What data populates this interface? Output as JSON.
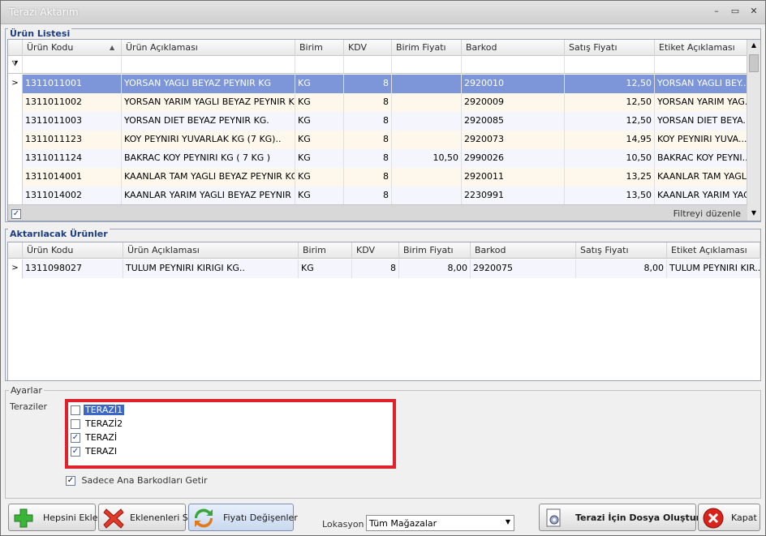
{
  "window": {
    "title": "Terazi Aktarım"
  },
  "product_list": {
    "title": "Ürün Listesi",
    "columns": [
      "Ürün Kodu",
      "Ürün Açıklaması",
      "Birim",
      "KDV",
      "Birim Fiyatı",
      "Barkod",
      "Satış Fiyatı",
      "Etiket Açıklaması"
    ],
    "rows": [
      [
        "1311011001",
        "YORSAN YAGLI BEYAZ PEYNIR KG",
        "KG",
        "8",
        "",
        "2920010",
        "12,50",
        "YORSAN YAGLI BEY..."
      ],
      [
        "1311011002",
        "YORSAN YARIM YAGLI BEYAZ PEYNIR KG..",
        "KG",
        "8",
        "",
        "2920009",
        "12,50",
        "YORSAN YARIM YAG..."
      ],
      [
        "1311011003",
        "YORSAN DIET BEYAZ PEYNIR KG.",
        "KG",
        "8",
        "",
        "2920085",
        "12,50",
        "YORSAN DIET BEYA..."
      ],
      [
        "1311011123",
        "KOY PEYNIRI YUVARLAK KG (7 KG)..",
        "KG",
        "8",
        "",
        "2920073",
        "14,95",
        "KOY PEYNIRI YUVA..."
      ],
      [
        "1311011124",
        "BAKRAC KOY PEYNIRI KG ( 7 KG )",
        "KG",
        "8",
        "10,50",
        "2990026",
        "10,50",
        "BAKRAC KOY PEYNI..."
      ],
      [
        "1311014001",
        "KAANLAR TAM YAGLI BEYAZ PEYNIR KG",
        "KG",
        "8",
        "",
        "2920011",
        "13,25",
        "KAANLAR TAM YAGLI..."
      ],
      [
        "1311014002",
        "KAANLAR YARIM YAGLI BEYAZ PEYNIR KG",
        "KG",
        "8",
        "",
        "2230991",
        "13,50",
        "KAANLAR YARIM YAG..."
      ]
    ],
    "filter_edit": "Filtreyi düzenle"
  },
  "transfer_list": {
    "title": "Aktarılacak Ürünler",
    "columns": [
      "Ürün Kodu",
      "Ürün Açıklaması",
      "Birim",
      "KDV",
      "Birim Fiyatı",
      "Barkod",
      "Satış Fiyatı",
      "Etiket Açıklaması"
    ],
    "rows": [
      [
        "1311098027",
        "TULUM PEYNIRI KIRIGI KG..",
        "KG",
        "8",
        "8,00",
        "2920075",
        "8,00",
        "TULUM PEYNIRI KIR..."
      ]
    ]
  },
  "settings": {
    "title": "Ayarlar",
    "scales_label": "Teraziler",
    "scales": [
      {
        "name": "TERAZİ1",
        "checked": false
      },
      {
        "name": "TERAZİ2",
        "checked": false
      },
      {
        "name": "TERAZİ",
        "checked": true
      },
      {
        "name": "TERAZI",
        "checked": true
      }
    ],
    "main_barcodes_label": "Sadece Ana Barkodları Getir",
    "main_barcodes_checked": true
  },
  "buttons": {
    "add_all": "Hepsini Ekle",
    "remove_added": "Eklenenleri Sil",
    "price_changed": "Fiyatı Değişenler",
    "create_file": "Terazi İçin Dosya Oluştur",
    "close": "Kapat"
  },
  "location": {
    "label": "Lokasyon",
    "value": "Tüm Mağazalar"
  },
  "colors": {
    "highlight_box": "#e0202a",
    "selected_row": "#7c96d9",
    "group_title": "#1c3d82"
  }
}
